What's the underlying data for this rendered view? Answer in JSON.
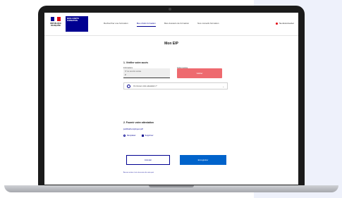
{
  "header": {
    "rf_text": "RÉPUBLIQUE FRANÇAISE",
    "brand_text": "MON COMPTE FORMATION",
    "nav": [
      "Rechercher une formation",
      "Mes droits formation",
      "Mes dossiers de formation",
      "Nos conseils formation"
    ],
    "active_nav_index": 1,
    "user_link": "Se déconnecter"
  },
  "main": {
    "title": "Mon EIP",
    "section1_title": "1. Vérifier votre accès",
    "field_label": "Informations",
    "field_placeholder": "N° de sécurité sociale",
    "field_value": "2",
    "button_top_label": "Action requise",
    "button_label": "Valider",
    "search_text": "Où trouver votre attestation ?",
    "section2_title": "2. Fournir votre attestation",
    "link_text": "justificatif-employeur.pdf",
    "action1": "Remplacer",
    "action2": "Supprimer",
    "cancel_label": "Annuler",
    "submit_label": "Enregistrer",
    "footnote": "Aucune action n'est nécessaire de votre part"
  },
  "colors": {
    "primary_blue": "#000091",
    "accent_red": "#ee6a6f",
    "button_blue": "#0063cb"
  }
}
